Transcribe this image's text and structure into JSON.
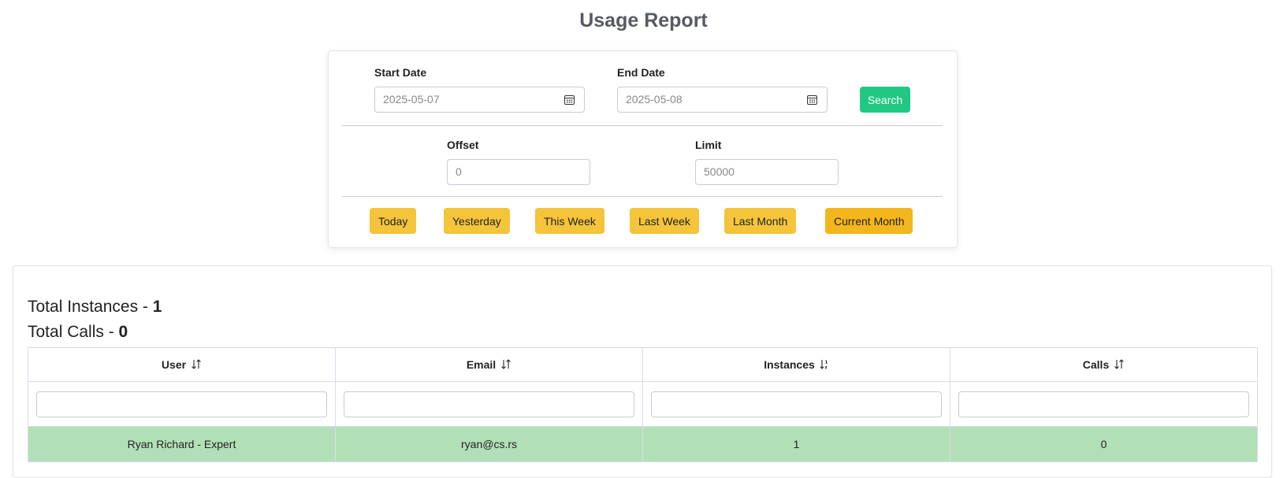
{
  "page": {
    "title": "Usage Report"
  },
  "filters": {
    "start_date": {
      "label": "Start Date",
      "value": "2025-05-07"
    },
    "end_date": {
      "label": "End Date",
      "value": "2025-05-08"
    },
    "search_label": "Search",
    "offset": {
      "label": "Offset",
      "value": "0"
    },
    "limit": {
      "label": "Limit",
      "value": "50000"
    },
    "quick_ranges": [
      "Today",
      "Yesterday",
      "This Week",
      "Last Week",
      "Last Month",
      "Current Month"
    ],
    "active_range": "Current Month"
  },
  "summary": {
    "instances_label": "Total Instances - ",
    "instances_value": "1",
    "calls_label": "Total Calls - ",
    "calls_value": "0"
  },
  "table": {
    "columns": [
      {
        "label": "User",
        "sort_icon": "sort-both-icon"
      },
      {
        "label": "Email",
        "sort_icon": "sort-both-icon"
      },
      {
        "label": "Instances",
        "sort_icon": "sort-ascending-icon"
      },
      {
        "label": "Calls",
        "sort_icon": "sort-both-icon"
      }
    ],
    "rows": [
      [
        "Ryan Richard - Expert",
        "ryan@cs.rs",
        "1",
        "0"
      ]
    ]
  },
  "colors": {
    "search_button": "#22c784",
    "quick_button": "#f4c43b",
    "row_highlight": "#b2e0b6",
    "title": "#555a63"
  }
}
